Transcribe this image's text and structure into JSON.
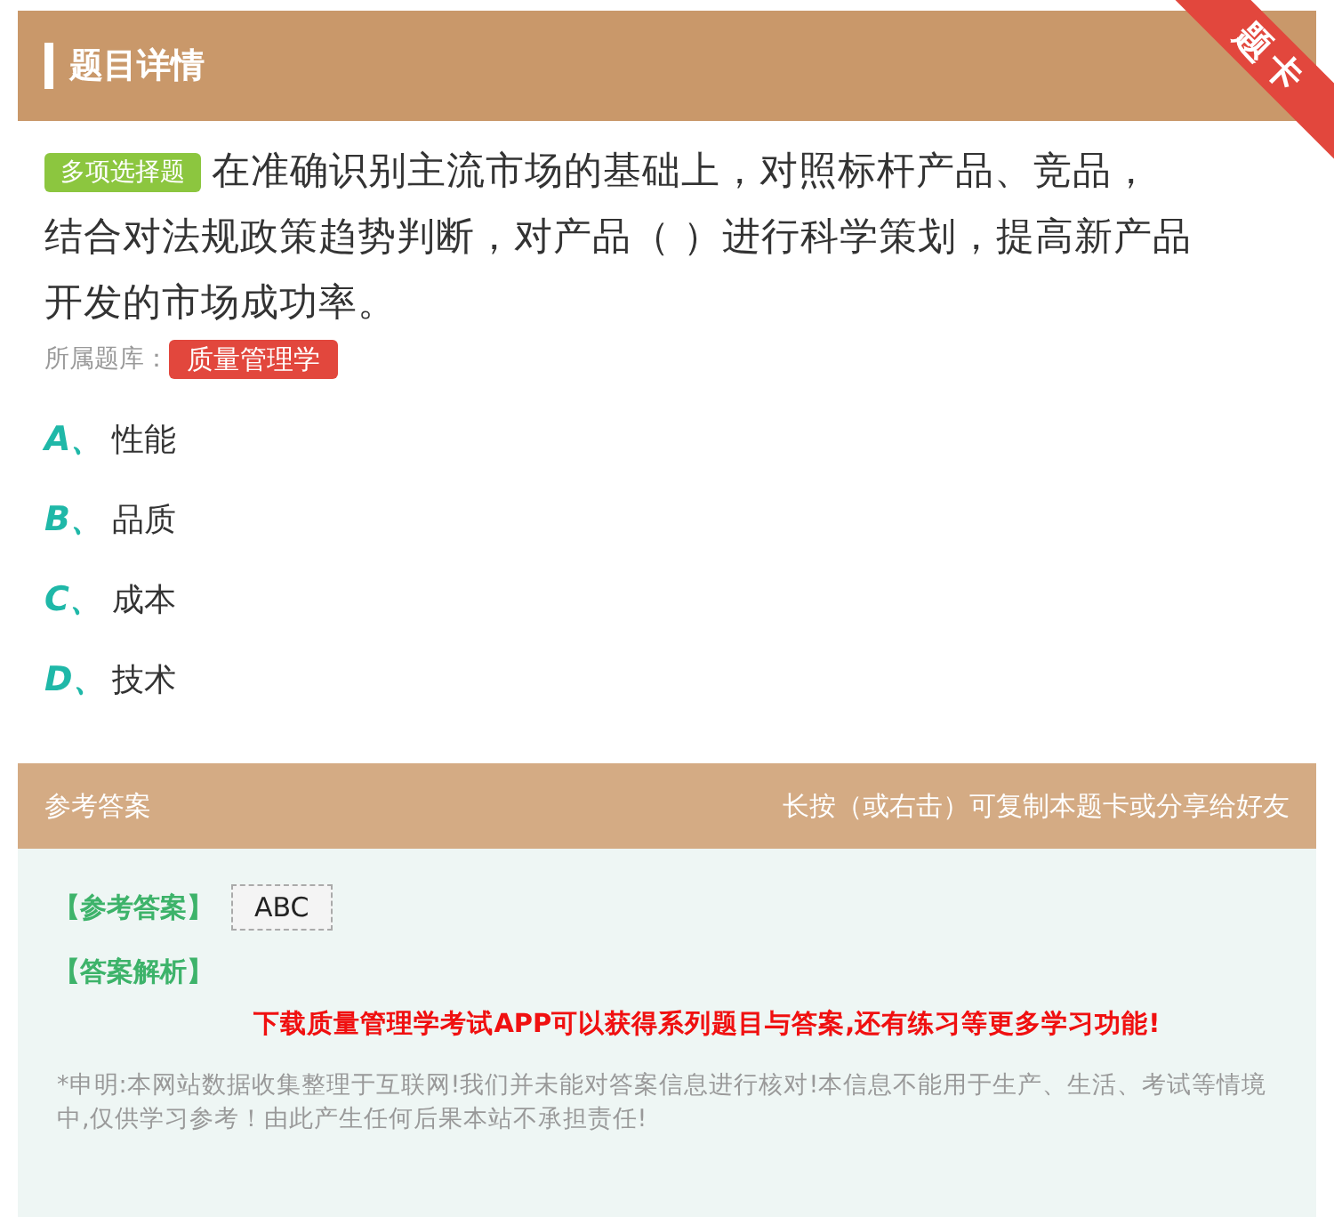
{
  "header": {
    "title": "题目详情",
    "ribbon": "题卡"
  },
  "question": {
    "type_tag": "多项选择题",
    "text_lines": [
      "在准确识别主流市场的基础上，对照标杆产品、竞品，",
      "结合对法规政策趋势判断，对产品（ ）进行科学策划，提高新产品",
      "开发的市场成功率。"
    ]
  },
  "bank": {
    "label": "所属题库：",
    "tag": "质量管理学"
  },
  "options": [
    {
      "letter": "A、",
      "text": "性能"
    },
    {
      "letter": "B、",
      "text": "品质"
    },
    {
      "letter": "C、",
      "text": "成本"
    },
    {
      "letter": "D、",
      "text": "技术"
    }
  ],
  "answer_bar": {
    "title": "参考答案",
    "hint": "长按（或右击）可复制本题卡或分享给好友"
  },
  "answer": {
    "label": "【参考答案】",
    "value": "ABC",
    "analysis_label": "【答案解析】",
    "promo": "下载质量管理学考试APP可以获得系列题目与答案,还有练习等更多学习功能!",
    "disclaimer": "*申明:本网站数据收集整理于互联网!我们并未能对答案信息进行核对!本信息不能用于生产、生活、考试等情境中,仅供学习参考！由此产生任何后果本站不承担责任!"
  }
}
